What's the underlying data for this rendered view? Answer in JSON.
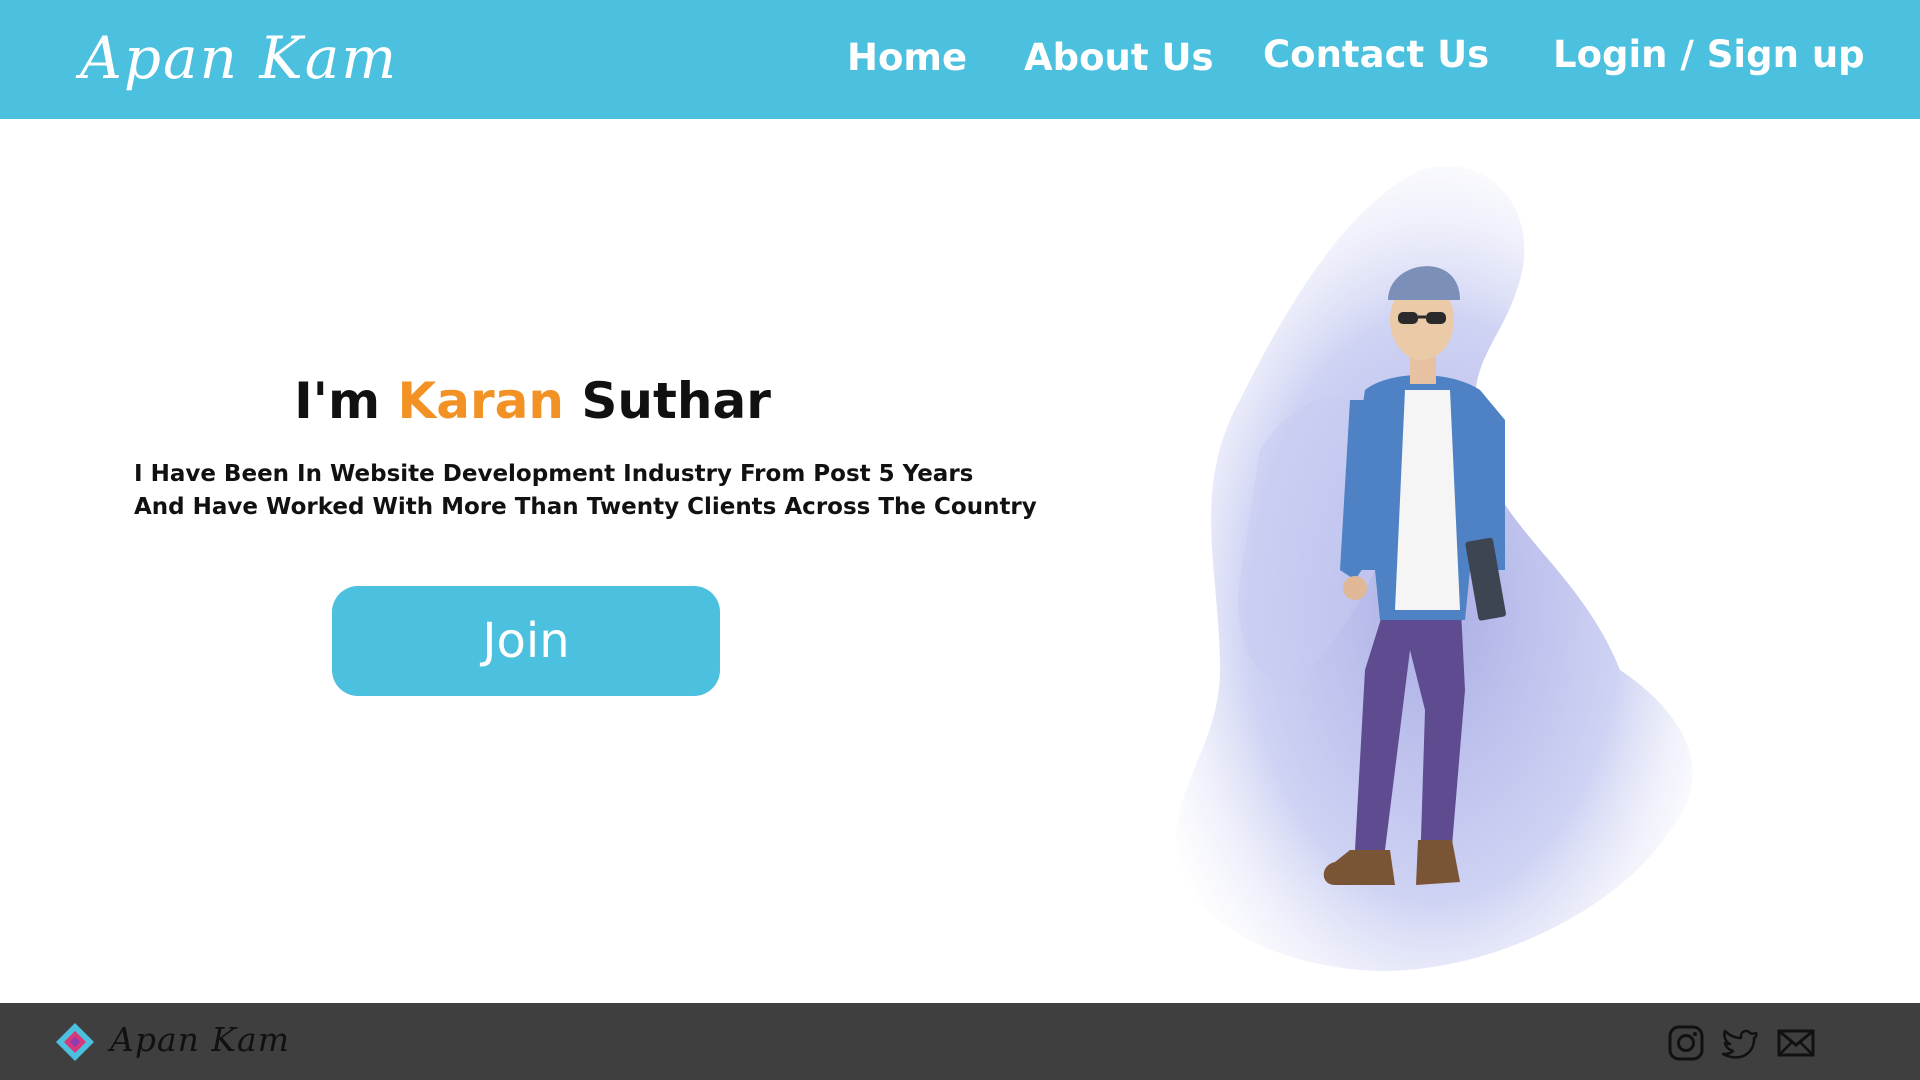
{
  "header": {
    "brand": "Apan Kam",
    "nav": {
      "home": "Home",
      "about": "About Us",
      "contact": "Contact Us",
      "login": "Login / Sign up"
    }
  },
  "hero": {
    "title_prefix": "I'm ",
    "title_highlight": "Karan",
    "title_suffix": " Suthar",
    "description_line1": "I Have Been In Website Development Industry From Post 5 Years",
    "description_line2": "And Have Worked With More Than Twenty Clients Across The Country",
    "join_label": "Join"
  },
  "footer": {
    "brand": "Apan Kam",
    "social_icons": [
      "instagram-icon",
      "twitter-icon",
      "mail-icon"
    ]
  },
  "colors": {
    "primary": "#4cc0df",
    "accent": "#f39224",
    "footer_bg": "#3f3f3f",
    "text": "#111111"
  }
}
